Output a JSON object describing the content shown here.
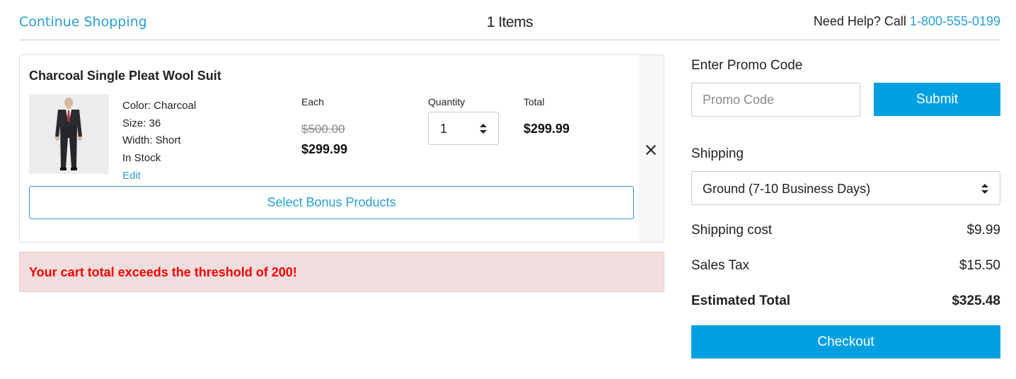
{
  "header": {
    "continue_label": "Continue Shopping",
    "items_count": "1 Items",
    "help_text": "Need Help? Call ",
    "phone": "1-800-555-0199"
  },
  "product": {
    "name": "Charcoal Single Pleat Wool Suit",
    "image_icon": "suit-photo",
    "attributes": [
      "Color: Charcoal",
      "Size: 36",
      "Width: Short",
      "In Stock"
    ],
    "edit_label": "Edit",
    "each_label": "Each",
    "original_price": "$500.00",
    "sale_price": "$299.99",
    "quantity_label": "Quantity",
    "quantity_value": "1",
    "total_label": "Total",
    "total_price": "$299.99",
    "bonus_label": "Select Bonus Products",
    "remove_icon": "close-icon"
  },
  "alert": {
    "message": "Your cart total exceeds the threshold of 200!"
  },
  "summary": {
    "promo_label": "Enter Promo Code",
    "promo_placeholder": "Promo Code",
    "submit_label": "Submit",
    "shipping_label": "Shipping",
    "shipping_method": "Ground (7-10 Business Days)",
    "shipping_cost_label": "Shipping cost",
    "shipping_cost": "$9.99",
    "sales_tax_label": "Sales Tax",
    "sales_tax": "$15.50",
    "estimated_total_label": "Estimated Total",
    "estimated_total": "$325.48",
    "checkout_label": "Checkout"
  },
  "colors": {
    "accent": "#00a0e0",
    "link": "#2a9fd6",
    "alert_bg": "#f2dede",
    "alert_text": "#ff0000"
  }
}
